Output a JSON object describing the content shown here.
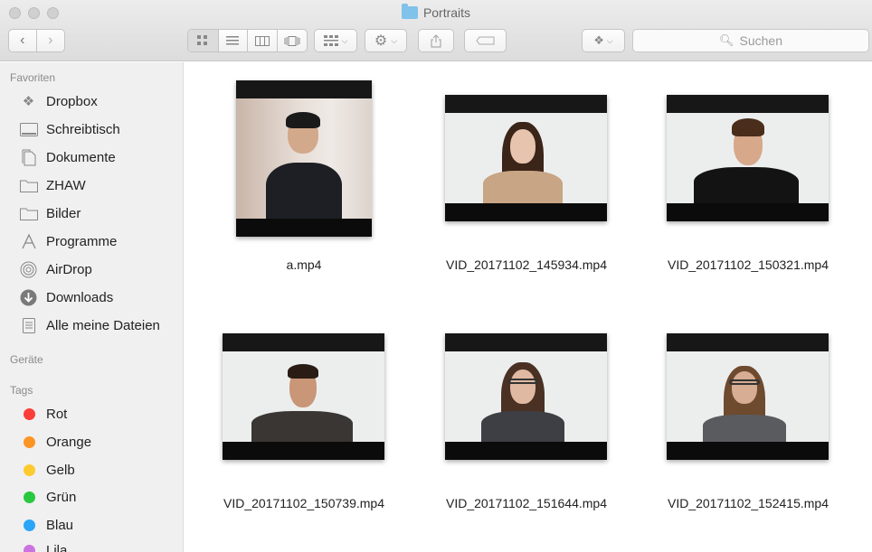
{
  "window": {
    "title": "Portraits"
  },
  "toolbar": {
    "back_icon": "chevron-left-icon",
    "forward_icon": "chevron-right-icon",
    "search_placeholder": "Suchen"
  },
  "sidebar": {
    "favorites_header": "Favoriten",
    "favorites": [
      {
        "label": "Dropbox",
        "icon": "dropbox-icon"
      },
      {
        "label": "Schreibtisch",
        "icon": "desktop-icon"
      },
      {
        "label": "Dokumente",
        "icon": "documents-icon"
      },
      {
        "label": "ZHAW",
        "icon": "folder-icon"
      },
      {
        "label": "Bilder",
        "icon": "folder-icon"
      },
      {
        "label": "Programme",
        "icon": "applications-icon"
      },
      {
        "label": "AirDrop",
        "icon": "airdrop-icon"
      },
      {
        "label": "Downloads",
        "icon": "downloads-icon"
      },
      {
        "label": "Alle meine Dateien",
        "icon": "all-files-icon"
      }
    ],
    "devices_header": "Geräte",
    "tags_header": "Tags",
    "tags": [
      {
        "label": "Rot",
        "color": "#fc3d39"
      },
      {
        "label": "Orange",
        "color": "#fd9426"
      },
      {
        "label": "Gelb",
        "color": "#fecb2f"
      },
      {
        "label": "Grün",
        "color": "#28c840"
      },
      {
        "label": "Blau",
        "color": "#2ba5f7"
      },
      {
        "label": "Lila",
        "color": "#cc73e1"
      }
    ]
  },
  "files": [
    {
      "name": "a.mp4"
    },
    {
      "name": "VID_20171102_145934.mp4"
    },
    {
      "name": "VID_20171102_150321.mp4"
    },
    {
      "name": "VID_20171102_150739.mp4"
    },
    {
      "name": "VID_20171102_151644.mp4"
    },
    {
      "name": "VID_20171102_152415.mp4"
    }
  ]
}
